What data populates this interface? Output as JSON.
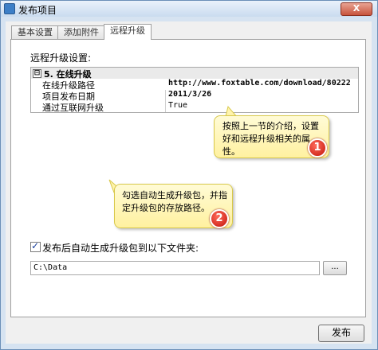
{
  "window": {
    "title": "发布项目",
    "close_label": "X"
  },
  "tabs": [
    {
      "label": "基本设置"
    },
    {
      "label": "添加附件"
    },
    {
      "label": "远程升级"
    }
  ],
  "panel": {
    "section_label": "远程升级设置:",
    "grid": {
      "category_expander": "⊟",
      "category": "5. 在线升级",
      "rows": [
        {
          "name": "在线升级路径",
          "value": "http://www.foxtable.com/download/80222"
        },
        {
          "name": "项目发布日期",
          "value": "2011/3/26"
        },
        {
          "name": "通过互联网升级",
          "value": "True"
        }
      ]
    },
    "callout1": {
      "text": "按照上一节的介绍，设置好和远程升级相关的属性。",
      "badge": "1"
    },
    "callout2": {
      "text": "勾选自动生成升级包，并指定升级包的存放路径。",
      "badge": "2"
    },
    "checkbox": {
      "checked": true,
      "label": "发布后自动生成升级包到以下文件夹:"
    },
    "path_input": {
      "value": "C:\\Data"
    },
    "browse_button": "..."
  },
  "footer": {
    "publish_label": "发布"
  },
  "colors": {
    "accent": "#3d7fc7",
    "callout_bg": "#fff6b8",
    "badge": "#d41e10"
  }
}
